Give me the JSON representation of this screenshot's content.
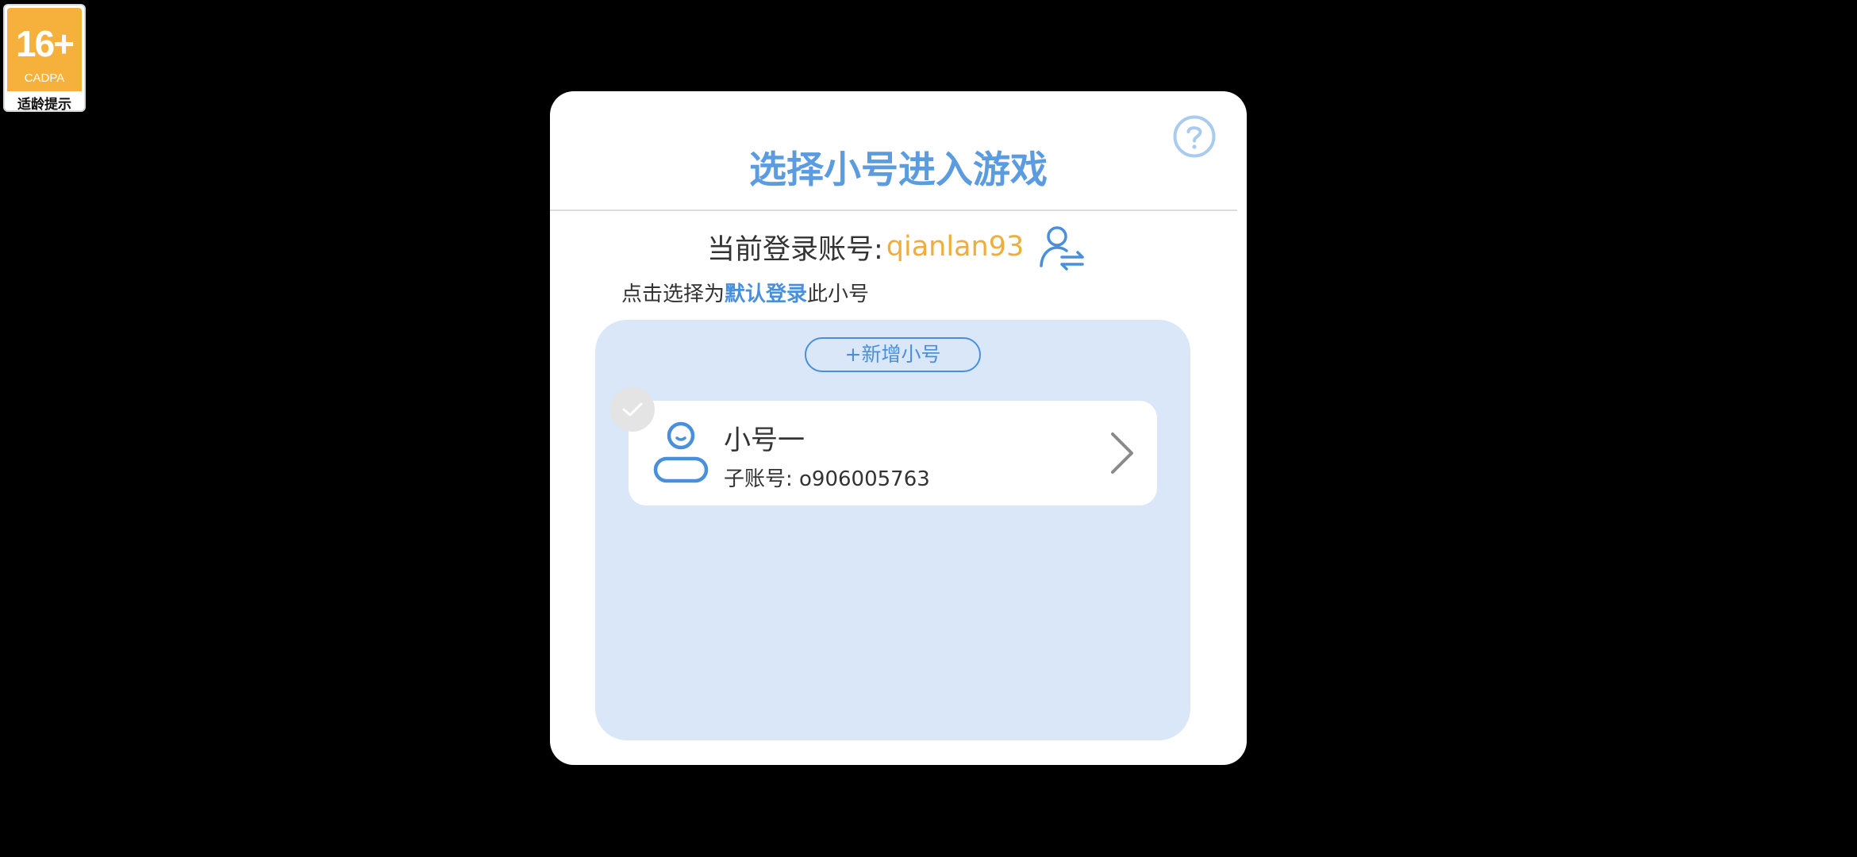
{
  "age_badge": {
    "rating": "16+",
    "org": "CADPA",
    "label": "适龄提示"
  },
  "dialog": {
    "title": "选择小号进入游戏",
    "current_account_label": "当前登录账号:",
    "current_account_name": "qianlan93",
    "hint_prefix": "点击选择为",
    "hint_highlight": "默认登录",
    "hint_suffix": "此小号",
    "add_button_label": "+新增小号",
    "accounts": [
      {
        "name": "小号一",
        "sub_label": "子账号: o906005763"
      }
    ]
  },
  "colors": {
    "accent": "#4a8fd9",
    "title": "#5b9bdf",
    "account_name": "#efad3c",
    "panel_bg": "#d9e7f8",
    "badge_orange": "#f6b13d"
  },
  "icons": {
    "help": "help-icon",
    "switch_account": "switch-account-icon",
    "avatar": "user-avatar-icon",
    "check": "check-icon",
    "chevron": "chevron-right-icon"
  }
}
